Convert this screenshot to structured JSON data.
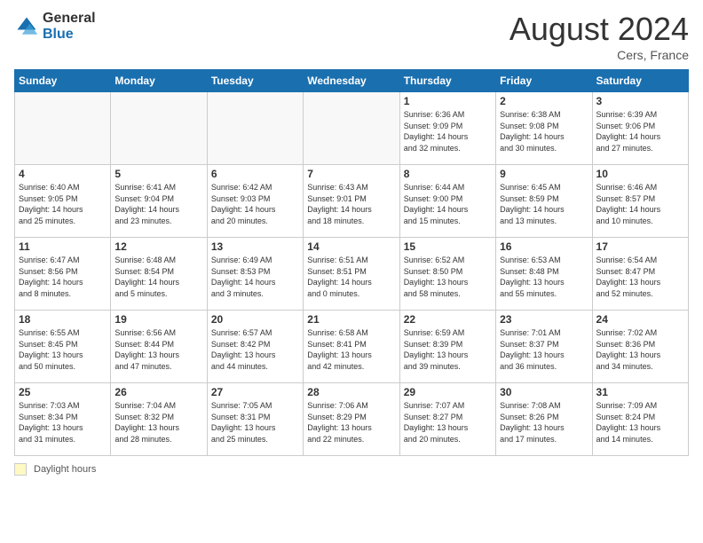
{
  "header": {
    "logo_general": "General",
    "logo_blue": "Blue",
    "month_title": "August 2024",
    "location": "Cers, France"
  },
  "weekdays": [
    "Sunday",
    "Monday",
    "Tuesday",
    "Wednesday",
    "Thursday",
    "Friday",
    "Saturday"
  ],
  "weeks": [
    [
      {
        "day": "",
        "info": ""
      },
      {
        "day": "",
        "info": ""
      },
      {
        "day": "",
        "info": ""
      },
      {
        "day": "",
        "info": ""
      },
      {
        "day": "1",
        "info": "Sunrise: 6:36 AM\nSunset: 9:09 PM\nDaylight: 14 hours\nand 32 minutes."
      },
      {
        "day": "2",
        "info": "Sunrise: 6:38 AM\nSunset: 9:08 PM\nDaylight: 14 hours\nand 30 minutes."
      },
      {
        "day": "3",
        "info": "Sunrise: 6:39 AM\nSunset: 9:06 PM\nDaylight: 14 hours\nand 27 minutes."
      }
    ],
    [
      {
        "day": "4",
        "info": "Sunrise: 6:40 AM\nSunset: 9:05 PM\nDaylight: 14 hours\nand 25 minutes."
      },
      {
        "day": "5",
        "info": "Sunrise: 6:41 AM\nSunset: 9:04 PM\nDaylight: 14 hours\nand 23 minutes."
      },
      {
        "day": "6",
        "info": "Sunrise: 6:42 AM\nSunset: 9:03 PM\nDaylight: 14 hours\nand 20 minutes."
      },
      {
        "day": "7",
        "info": "Sunrise: 6:43 AM\nSunset: 9:01 PM\nDaylight: 14 hours\nand 18 minutes."
      },
      {
        "day": "8",
        "info": "Sunrise: 6:44 AM\nSunset: 9:00 PM\nDaylight: 14 hours\nand 15 minutes."
      },
      {
        "day": "9",
        "info": "Sunrise: 6:45 AM\nSunset: 8:59 PM\nDaylight: 14 hours\nand 13 minutes."
      },
      {
        "day": "10",
        "info": "Sunrise: 6:46 AM\nSunset: 8:57 PM\nDaylight: 14 hours\nand 10 minutes."
      }
    ],
    [
      {
        "day": "11",
        "info": "Sunrise: 6:47 AM\nSunset: 8:56 PM\nDaylight: 14 hours\nand 8 minutes."
      },
      {
        "day": "12",
        "info": "Sunrise: 6:48 AM\nSunset: 8:54 PM\nDaylight: 14 hours\nand 5 minutes."
      },
      {
        "day": "13",
        "info": "Sunrise: 6:49 AM\nSunset: 8:53 PM\nDaylight: 14 hours\nand 3 minutes."
      },
      {
        "day": "14",
        "info": "Sunrise: 6:51 AM\nSunset: 8:51 PM\nDaylight: 14 hours\nand 0 minutes."
      },
      {
        "day": "15",
        "info": "Sunrise: 6:52 AM\nSunset: 8:50 PM\nDaylight: 13 hours\nand 58 minutes."
      },
      {
        "day": "16",
        "info": "Sunrise: 6:53 AM\nSunset: 8:48 PM\nDaylight: 13 hours\nand 55 minutes."
      },
      {
        "day": "17",
        "info": "Sunrise: 6:54 AM\nSunset: 8:47 PM\nDaylight: 13 hours\nand 52 minutes."
      }
    ],
    [
      {
        "day": "18",
        "info": "Sunrise: 6:55 AM\nSunset: 8:45 PM\nDaylight: 13 hours\nand 50 minutes."
      },
      {
        "day": "19",
        "info": "Sunrise: 6:56 AM\nSunset: 8:44 PM\nDaylight: 13 hours\nand 47 minutes."
      },
      {
        "day": "20",
        "info": "Sunrise: 6:57 AM\nSunset: 8:42 PM\nDaylight: 13 hours\nand 44 minutes."
      },
      {
        "day": "21",
        "info": "Sunrise: 6:58 AM\nSunset: 8:41 PM\nDaylight: 13 hours\nand 42 minutes."
      },
      {
        "day": "22",
        "info": "Sunrise: 6:59 AM\nSunset: 8:39 PM\nDaylight: 13 hours\nand 39 minutes."
      },
      {
        "day": "23",
        "info": "Sunrise: 7:01 AM\nSunset: 8:37 PM\nDaylight: 13 hours\nand 36 minutes."
      },
      {
        "day": "24",
        "info": "Sunrise: 7:02 AM\nSunset: 8:36 PM\nDaylight: 13 hours\nand 34 minutes."
      }
    ],
    [
      {
        "day": "25",
        "info": "Sunrise: 7:03 AM\nSunset: 8:34 PM\nDaylight: 13 hours\nand 31 minutes."
      },
      {
        "day": "26",
        "info": "Sunrise: 7:04 AM\nSunset: 8:32 PM\nDaylight: 13 hours\nand 28 minutes."
      },
      {
        "day": "27",
        "info": "Sunrise: 7:05 AM\nSunset: 8:31 PM\nDaylight: 13 hours\nand 25 minutes."
      },
      {
        "day": "28",
        "info": "Sunrise: 7:06 AM\nSunset: 8:29 PM\nDaylight: 13 hours\nand 22 minutes."
      },
      {
        "day": "29",
        "info": "Sunrise: 7:07 AM\nSunset: 8:27 PM\nDaylight: 13 hours\nand 20 minutes."
      },
      {
        "day": "30",
        "info": "Sunrise: 7:08 AM\nSunset: 8:26 PM\nDaylight: 13 hours\nand 17 minutes."
      },
      {
        "day": "31",
        "info": "Sunrise: 7:09 AM\nSunset: 8:24 PM\nDaylight: 13 hours\nand 14 minutes."
      }
    ]
  ],
  "footer": {
    "daylight_label": "Daylight hours"
  }
}
